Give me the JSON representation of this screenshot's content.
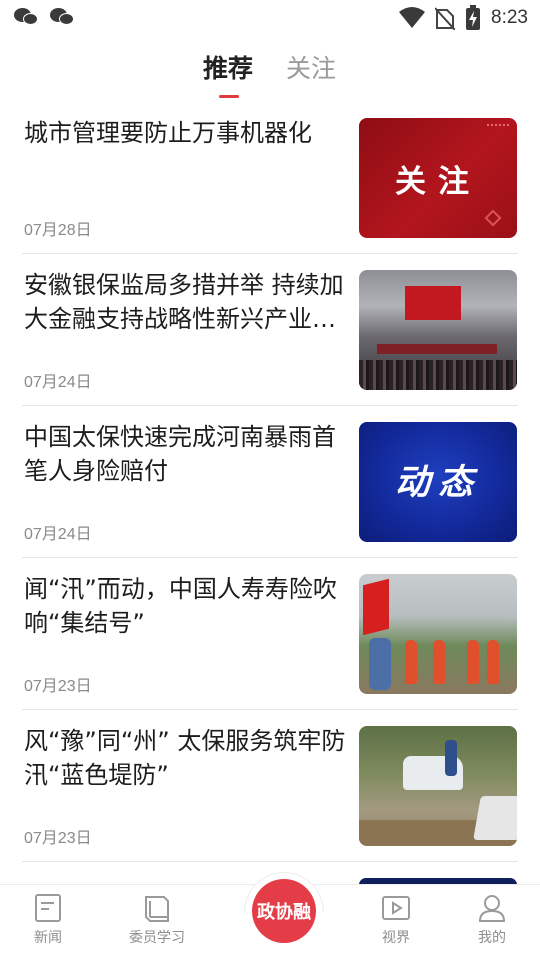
{
  "status_bar": {
    "time": "8:23",
    "left_icons": [
      "wechat-icon",
      "wechat-icon"
    ],
    "right_icons": [
      "wifi-icon",
      "no-sim-icon",
      "battery-charging-icon"
    ]
  },
  "tabs": [
    {
      "label": "推荐",
      "active": true
    },
    {
      "label": "关注",
      "active": false
    }
  ],
  "accent_color": "#e23a41",
  "feed": [
    {
      "title": "城市管理要防止万事机器化",
      "date": "07月28日",
      "thumb_text": "关注"
    },
    {
      "title": "安徽银保监局多措并举 持续加大金融支持战略性新兴产业发展",
      "date": "07月24日",
      "thumb_text": ""
    },
    {
      "title": "中国太保快速完成河南暴雨首笔人身险赔付",
      "date": "07月24日",
      "thumb_text": "动态"
    },
    {
      "title": "闻“汛”而动，中国人寿寿险吹响“集结号”",
      "date": "07月23日",
      "thumb_text": ""
    },
    {
      "title": "风“豫”同“州” 太保服务筑牢防汛“蓝色堤防”",
      "date": "07月23日",
      "thumb_text": ""
    }
  ],
  "bottom_nav": {
    "news": "新闻",
    "study": "委员学习",
    "center": "政协融",
    "vision": "视界",
    "mine": "我的"
  }
}
